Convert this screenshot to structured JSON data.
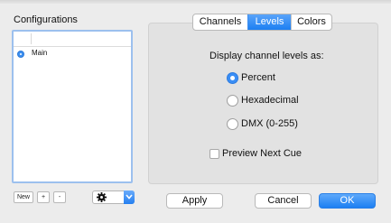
{
  "configurations": {
    "title": "Configurations",
    "items": [
      {
        "label": "Main",
        "selected": true
      }
    ],
    "buttons": {
      "new": "New",
      "add": "+",
      "remove": "-"
    },
    "action_menu_icon": "gear-icon"
  },
  "tabs": [
    {
      "label": "Channels",
      "active": false
    },
    {
      "label": "Levels",
      "active": true
    },
    {
      "label": "Colors",
      "active": false
    }
  ],
  "levels": {
    "prompt": "Display channel levels as:",
    "options": [
      {
        "label": "Percent",
        "selected": true
      },
      {
        "label": "Hexadecimal",
        "selected": false
      },
      {
        "label": "DMX (0-255)",
        "selected": false
      }
    ],
    "preview_next_cue": {
      "label": "Preview Next Cue",
      "checked": false
    }
  },
  "footer": {
    "apply": "Apply",
    "cancel": "Cancel",
    "ok": "OK"
  },
  "colors": {
    "accent": "#1c7ff2",
    "list_focus_border": "#9cc0ee",
    "background": "#ececec"
  }
}
